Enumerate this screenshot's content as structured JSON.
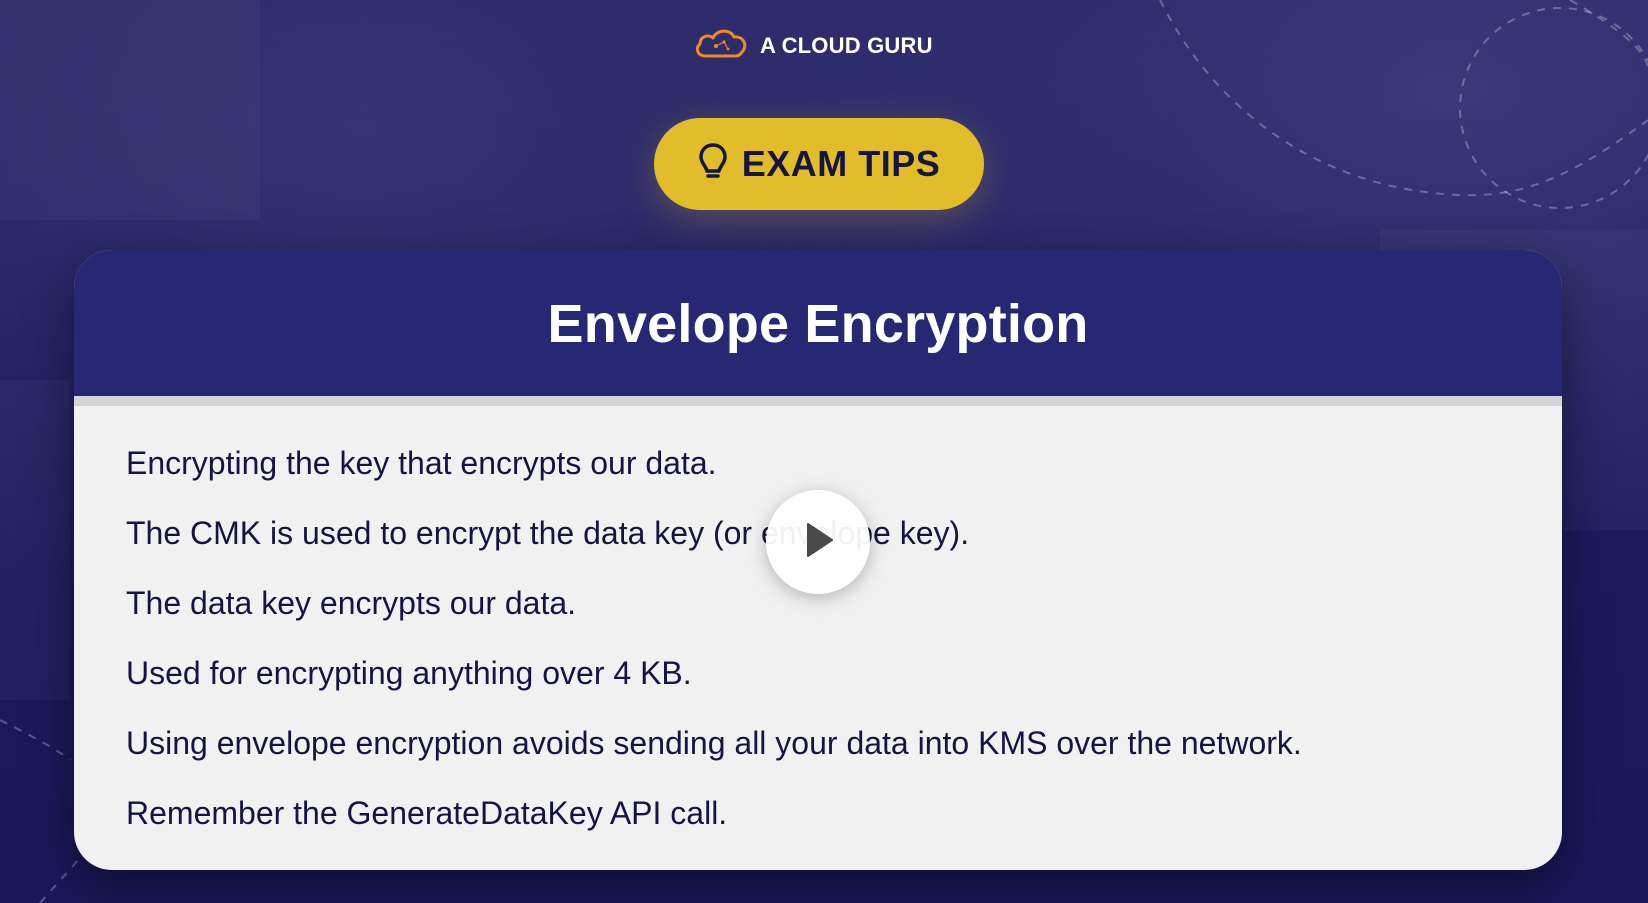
{
  "brand": {
    "name": "A CLOUD GURU",
    "logo_icon": "cloud-logo-icon",
    "accent_color": "#f08a24"
  },
  "badge": {
    "label": "EXAM TIPS",
    "icon": "lightbulb-icon",
    "color": "#e2bd2b"
  },
  "card": {
    "title": "Envelope Encryption",
    "header_color": "#272874",
    "lines": [
      "Encrypting the key that encrypts our data.",
      "The CMK is used to encrypt the data key (or envelope key).",
      "The data key encrypts our data.",
      "Used for encrypting anything over 4 KB.",
      "Using envelope encryption avoids sending all your data into KMS over the network.",
      "Remember the GenerateDataKey API call."
    ]
  },
  "player": {
    "play_icon": "play-icon"
  }
}
